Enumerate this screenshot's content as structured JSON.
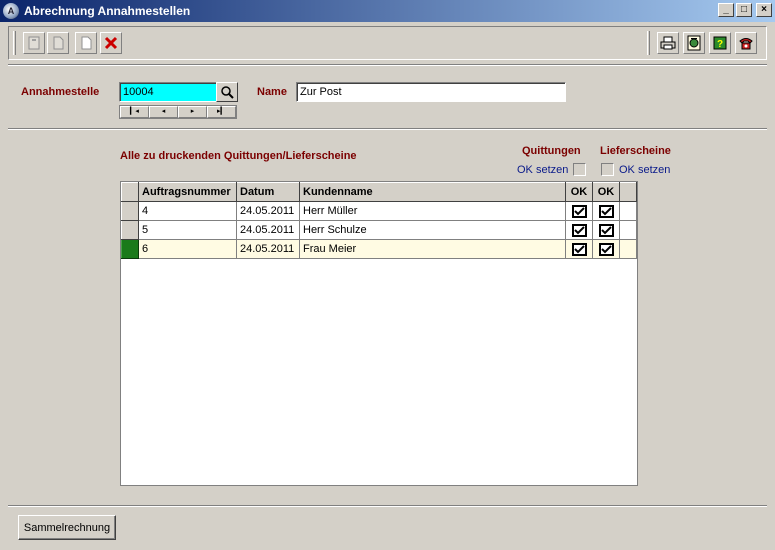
{
  "window": {
    "title": "Abrechnung Annahmestellen"
  },
  "toolbar": {
    "left_icons": [
      "new-document-icon",
      "copy-document-icon",
      "blank-document-icon",
      "delete-x-icon"
    ],
    "right_icons": [
      "printer-icon",
      "report-icon",
      "help-icon",
      "phone-icon"
    ]
  },
  "form": {
    "annahmestelle_label": "Annahmestelle",
    "annahmestelle_value": "10004",
    "name_label": "Name",
    "name_value": "Zur Post"
  },
  "section": {
    "heading": "Alle zu druckenden Quittungen/Lieferscheine",
    "quittungen_label": "Quittungen",
    "quittungen_ok": "OK setzen",
    "lieferscheine_label": "Lieferscheine",
    "lieferscheine_ok": "OK setzen"
  },
  "table": {
    "columns": [
      "Auftragsnummer",
      "Datum",
      "Kundenname",
      "OK",
      "OK"
    ],
    "rows": [
      {
        "nr": "4",
        "datum": "24.05.2011",
        "kunde": "Herr Müller",
        "ok1": true,
        "ok2": true
      },
      {
        "nr": "5",
        "datum": "24.05.2011",
        "kunde": "Herr Schulze",
        "ok1": true,
        "ok2": true
      },
      {
        "nr": "6",
        "datum": "24.05.2011",
        "kunde": "Frau Meier",
        "ok1": true,
        "ok2": true
      }
    ]
  },
  "footer": {
    "button_label": "Sammelrechnung"
  },
  "colors": {
    "title_gradient_start": "#0a246a",
    "label_red": "#7b0000",
    "field_cyan": "#00ffff",
    "selected_row_marker": "#1a7a1a"
  }
}
